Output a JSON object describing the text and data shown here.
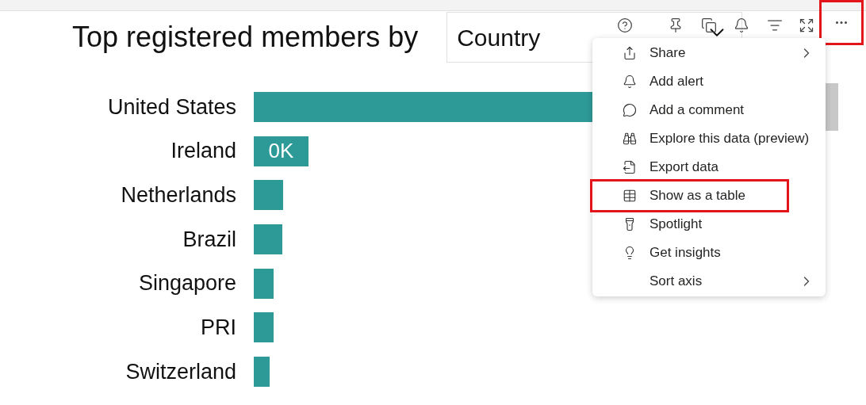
{
  "visual": {
    "title": "Top registered members by",
    "dropdown": {
      "value": "Country"
    }
  },
  "more_button": {
    "highlighted": true
  },
  "chart": {
    "rows": [
      {
        "label": "United States"
      },
      {
        "label": "Ireland",
        "data_label": "0K"
      },
      {
        "label": "Netherlands"
      },
      {
        "label": "Brazil"
      },
      {
        "label": "Singapore"
      },
      {
        "label": "PRI"
      },
      {
        "label": "Switzerland"
      }
    ]
  },
  "menu": {
    "items": [
      {
        "label": "Share",
        "submenu": true,
        "highlighted": false
      },
      {
        "label": "Add alert",
        "submenu": false,
        "highlighted": false
      },
      {
        "label": "Add a comment",
        "submenu": false,
        "highlighted": false
      },
      {
        "label": "Explore this data (preview)",
        "submenu": false,
        "highlighted": false
      },
      {
        "label": "Export data",
        "submenu": false,
        "highlighted": false
      },
      {
        "label": "Show as a table",
        "submenu": false,
        "highlighted": true
      },
      {
        "label": "Spotlight",
        "submenu": false,
        "highlighted": false
      },
      {
        "label": "Get insights",
        "submenu": false,
        "highlighted": false
      },
      {
        "label": "Sort axis",
        "submenu": true,
        "highlighted": false
      }
    ]
  }
}
